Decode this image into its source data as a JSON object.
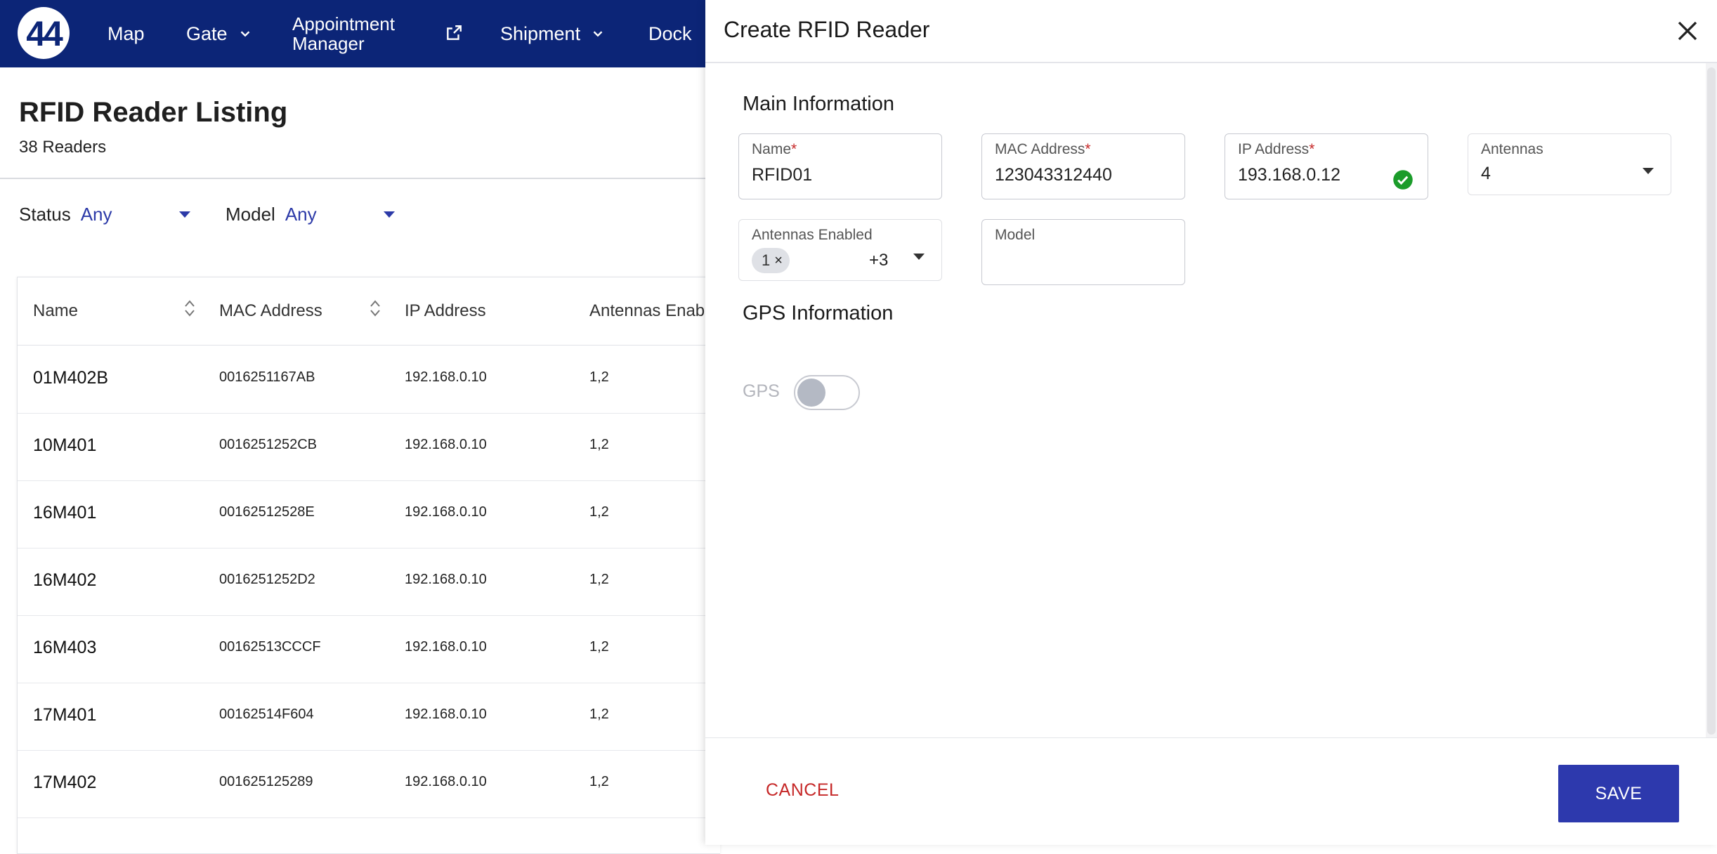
{
  "nav": {
    "logo": "44",
    "items": [
      "Map",
      "Gate",
      "Shipment",
      "Dock"
    ],
    "appointment_line1": "Appointment",
    "appointment_line2": "Manager"
  },
  "listing": {
    "title": "RFID Reader Listing",
    "count": "38 Readers",
    "filters": [
      {
        "label": "Status",
        "value": "Any"
      },
      {
        "label": "Model",
        "value": "Any"
      }
    ],
    "columns": [
      "Name",
      "MAC Address",
      "IP Address",
      "Antennas Enab"
    ],
    "rows": [
      {
        "name": "01M402B",
        "mac": "0016251167AB",
        "ip": "192.168.0.10",
        "antennas": "1,2"
      },
      {
        "name": "10M401",
        "mac": "0016251252CB",
        "ip": "192.168.0.10",
        "antennas": "1,2"
      },
      {
        "name": "16M401",
        "mac": "00162512528E",
        "ip": "192.168.0.10",
        "antennas": "1,2"
      },
      {
        "name": "16M402",
        "mac": "0016251252D2",
        "ip": "192.168.0.10",
        "antennas": "1,2"
      },
      {
        "name": "16M403",
        "mac": "00162513CCCF",
        "ip": "192.168.0.10",
        "antennas": "1,2"
      },
      {
        "name": "17M401",
        "mac": "00162514F604",
        "ip": "192.168.0.10",
        "antennas": "1,2"
      },
      {
        "name": "17M402",
        "mac": "001625125289",
        "ip": "192.168.0.10",
        "antennas": "1,2"
      }
    ]
  },
  "panel": {
    "title": "Create RFID Reader",
    "main_section": "Main Information",
    "fields": {
      "name": {
        "label": "Name",
        "value": "RFID01"
      },
      "mac": {
        "label": "MAC Address",
        "value": "123043312440"
      },
      "ip": {
        "label": "IP Address",
        "value": "193.168.0.12"
      },
      "antennas": {
        "label": "Antennas",
        "value": "4"
      },
      "antennas_enabled": {
        "label": "Antennas Enabled",
        "chip": "1",
        "more": "+3"
      },
      "model": {
        "label": "Model",
        "value": ""
      }
    },
    "required_mark": "*",
    "chip_remove": "×",
    "gps_section": "GPS Information",
    "gps_label": "GPS",
    "cancel": "CANCEL",
    "save": "SAVE"
  },
  "colors": {
    "nav_bg": "#0c2577",
    "accent": "#2d39ad",
    "danger": "#c62828",
    "valid": "#1b9c2a"
  }
}
